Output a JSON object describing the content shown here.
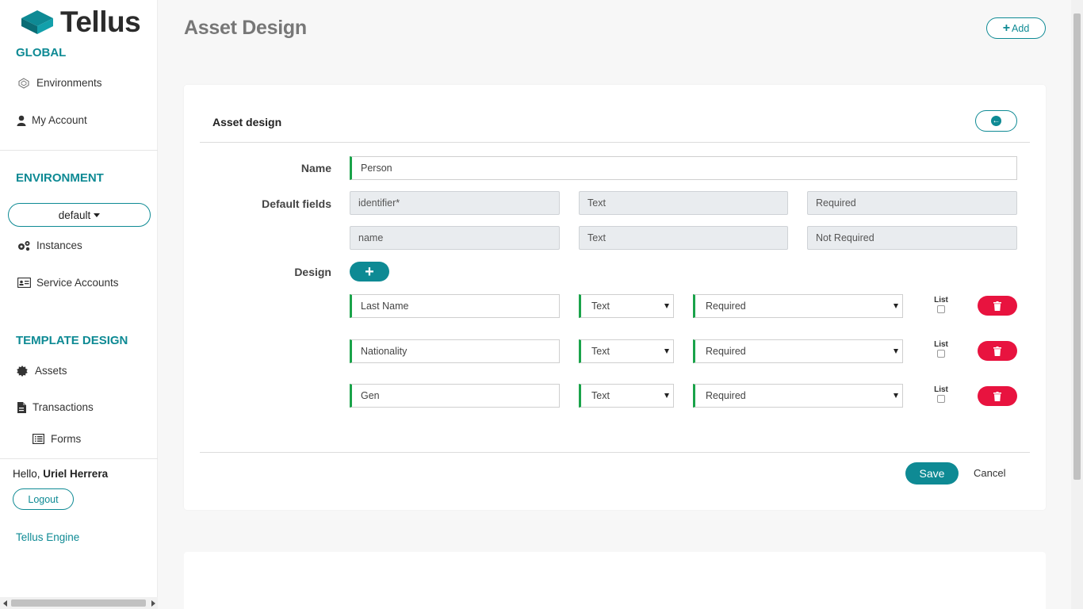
{
  "brand": {
    "name": "Tellus"
  },
  "sidebar": {
    "global_title": "GLOBAL",
    "global_items": [
      {
        "label": "Environments",
        "icon": "environments-icon"
      },
      {
        "label": "My Account",
        "icon": "user-icon"
      }
    ],
    "environment_title": "ENVIRONMENT",
    "environment_selected": "default",
    "environment_items": [
      {
        "label": "Instances",
        "icon": "gears-icon"
      },
      {
        "label": "Service Accounts",
        "icon": "id-card-icon"
      }
    ],
    "template_title": "TEMPLATE DESIGN",
    "template_items": [
      {
        "label": "Assets",
        "icon": "certificate-icon"
      },
      {
        "label": "Transactions",
        "icon": "file-icon"
      },
      {
        "label": "Forms",
        "icon": "list-icon"
      }
    ],
    "hello_prefix": "Hello,",
    "user_name": "Uriel Herrera",
    "logout_label": "Logout",
    "engine_link": "Tellus Engine"
  },
  "header": {
    "title": "Asset Design",
    "add_label": "Add"
  },
  "card": {
    "title": "Asset design",
    "name_label": "Name",
    "name_value": "Person",
    "default_fields_label": "Default fields",
    "default_fields": [
      [
        "identifier*",
        "Text",
        "Required"
      ],
      [
        "name",
        "Text",
        "Not Required"
      ]
    ],
    "design_label": "Design",
    "design_rows": [
      {
        "name": "Last Name",
        "type": "Text",
        "required": "Required",
        "list_label": "List"
      },
      {
        "name": "Nationality",
        "type": "Text",
        "required": "Required",
        "list_label": "List"
      },
      {
        "name": "Gen",
        "type": "Text",
        "required": "Required",
        "list_label": "List"
      }
    ],
    "save_label": "Save",
    "cancel_label": "Cancel"
  },
  "colors": {
    "accent": "#0e8a94",
    "danger": "#e8133f",
    "field_marker": "#1aa34a"
  }
}
